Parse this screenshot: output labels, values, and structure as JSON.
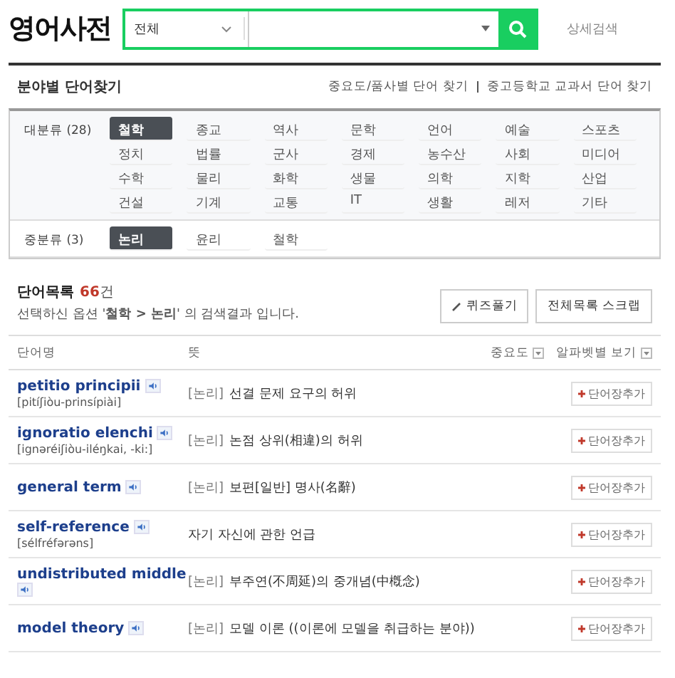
{
  "header": {
    "title": "영어사전",
    "search": {
      "scope": "전체"
    },
    "advanced_link": "상세검색"
  },
  "section": {
    "title": "분야별 단어찾기",
    "links": [
      "중요도/품사별 단어 찾기",
      "중고등학교 교과서 단어 찾기"
    ]
  },
  "major": {
    "label": "대분류 (28)",
    "items": [
      {
        "label": "철학",
        "selected": true
      },
      {
        "label": "종교",
        "selected": false
      },
      {
        "label": "역사",
        "selected": false
      },
      {
        "label": "문학",
        "selected": false
      },
      {
        "label": "언어",
        "selected": false
      },
      {
        "label": "예술",
        "selected": false
      },
      {
        "label": "스포츠",
        "selected": false
      },
      {
        "label": "정치",
        "selected": false
      },
      {
        "label": "법률",
        "selected": false
      },
      {
        "label": "군사",
        "selected": false
      },
      {
        "label": "경제",
        "selected": false
      },
      {
        "label": "농수산",
        "selected": false
      },
      {
        "label": "사회",
        "selected": false
      },
      {
        "label": "미디어",
        "selected": false
      },
      {
        "label": "수학",
        "selected": false
      },
      {
        "label": "물리",
        "selected": false
      },
      {
        "label": "화학",
        "selected": false
      },
      {
        "label": "생물",
        "selected": false
      },
      {
        "label": "의학",
        "selected": false
      },
      {
        "label": "지학",
        "selected": false
      },
      {
        "label": "산업",
        "selected": false
      },
      {
        "label": "건설",
        "selected": false
      },
      {
        "label": "기계",
        "selected": false
      },
      {
        "label": "교통",
        "selected": false
      },
      {
        "label": "IT",
        "selected": false
      },
      {
        "label": "생활",
        "selected": false
      },
      {
        "label": "레저",
        "selected": false
      },
      {
        "label": "기타",
        "selected": false
      }
    ]
  },
  "minor": {
    "label": "중분류 (3)",
    "items": [
      {
        "label": "논리",
        "selected": true
      },
      {
        "label": "윤리",
        "selected": false
      },
      {
        "label": "철학",
        "selected": false
      }
    ]
  },
  "results": {
    "title": "단어목록",
    "count": "66",
    "count_unit": "건",
    "summary": "선택하신 옵션 '**철학 > 논리**' 의 검색결과 입니다.",
    "buttons": [
      "퀴즈풀기",
      "전체목록 스크랩"
    ]
  },
  "table": {
    "columns": [
      "단어명",
      "뜻"
    ],
    "sort_options": [
      "중요도",
      "알파벳별 보기"
    ],
    "rows": [
      {
        "word": "petitio principii",
        "pronunciation": "[pitíʃiòu-prinsípiài]",
        "tag": "[논리]",
        "meaning": "선결 문제 요구의 허위",
        "action": "단어장추가"
      },
      {
        "word": "ignoratio elenchi",
        "pronunciation": "[ignəréiʃiòu-iléŋkai, -ki:]",
        "tag": "[논리]",
        "meaning": "논점 상위(相違)의 허위",
        "action": "단어장추가"
      },
      {
        "word": "general term",
        "tag": "[논리]",
        "meaning": "보편[일반] 명사(名辭)",
        "action": "단어장추가"
      },
      {
        "word": "self-reference",
        "pronunciation": "[sélfréfərəns]",
        "meaning": "자기 자신에 관한 언급",
        "action": "단어장추가"
      },
      {
        "word": "undistributed middle",
        "tag": "[논리]",
        "meaning": "부주연(不周延)의 중개념(中槪念)",
        "action": "단어장추가"
      },
      {
        "word": "model theory",
        "tag": "[논리]",
        "meaning": "모델 이론 ((이론에 모델을 취급하는 분야))",
        "action": "단어장추가"
      }
    ]
  }
}
